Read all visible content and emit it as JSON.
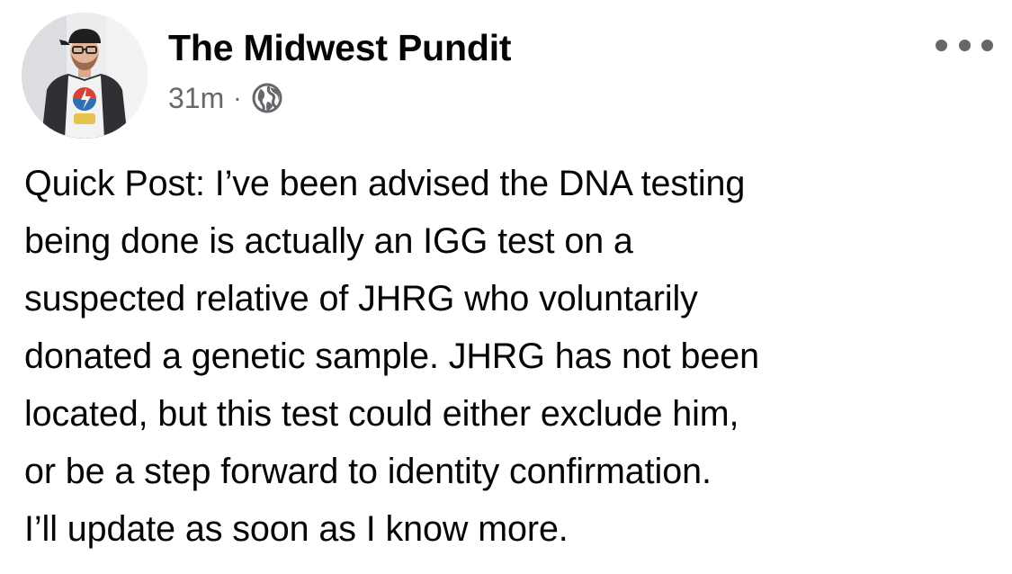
{
  "post": {
    "author": "The Midwest Pundit",
    "timestamp": "31m",
    "separator": "·",
    "audience_icon": "globe-icon",
    "more_icon": "more-options-icon",
    "avatar_icon": "profile-photo",
    "body_lines": [
      "Quick Post: I’ve been advised the DNA testing",
      "being done is actually an IGG test on a",
      "suspected relative of JHRG who voluntarily",
      "donated a genetic sample. JHRG has not been",
      "located, but this test could either exclude him,",
      "or be a step forward to identity confirmation.",
      "I’ll update as soon as I know more."
    ]
  },
  "colors": {
    "text": "#050505",
    "secondary_text": "#65676b",
    "background": "#ffffff"
  }
}
